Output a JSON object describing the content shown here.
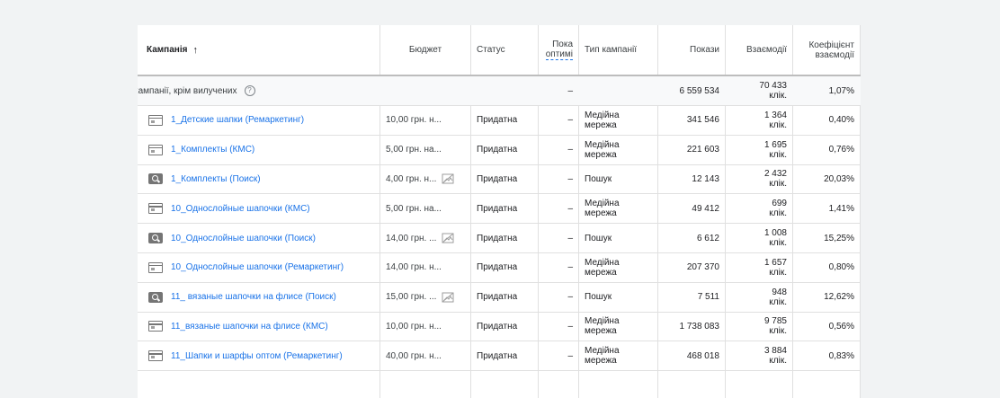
{
  "header": {
    "campaign": "Кампанія",
    "sort_arrow": "↑",
    "budget": "Бюджет",
    "status": "Статус",
    "opt_line1": "Пока",
    "opt_line2": "оптимі",
    "type": "Тип кампанії",
    "impr": "Покази",
    "interactions": "Взаємодії",
    "rate_line1": "Коефіцієнт",
    "rate_line2": "взаємодії"
  },
  "summary": {
    "label": "кампанії, крім вилучених",
    "help": "?",
    "opt": "–",
    "impr": "6 559 534",
    "inter1": "70 433",
    "inter2": "клік.",
    "rate": "1,07%"
  },
  "rows": [
    {
      "icon": "display",
      "name": "1_Детские шапки (Ремаркетинг)",
      "budget": "10,00 грн. н...",
      "noimg": false,
      "status": "Придатна",
      "opt": "–",
      "type1": "Медійна",
      "type2": "мережа",
      "impr": "341 546",
      "inter1": "1 364",
      "inter2": "клік.",
      "rate": "0,40%"
    },
    {
      "icon": "display",
      "name": "1_Комплекты (КМС)",
      "budget": "5,00 грн. на...",
      "noimg": false,
      "status": "Придатна",
      "opt": "–",
      "type1": "Медійна",
      "type2": "мережа",
      "impr": "221 603",
      "inter1": "1 695",
      "inter2": "клік.",
      "rate": "0,76%"
    },
    {
      "icon": "search",
      "name": "1_Комплекты (Поиск)",
      "budget": "4,00 грн. н...",
      "noimg": true,
      "status": "Придатна",
      "opt": "–",
      "type1": "Пошук",
      "type2": "",
      "impr": "12 143",
      "inter1": "2 432",
      "inter2": "клік.",
      "rate": "20,03%"
    },
    {
      "icon": "display",
      "name": "10_Однослойные шапочки (КМС)",
      "budget": "5,00 грн. на...",
      "noimg": false,
      "status": "Придатна",
      "opt": "–",
      "type1": "Медійна",
      "type2": "мережа",
      "impr": "49 412",
      "inter1": "699",
      "inter2": "клік.",
      "rate": "1,41%"
    },
    {
      "icon": "search",
      "name": "10_Однослойные шапочки (Поиск)",
      "budget": "14,00 грн. ...",
      "noimg": true,
      "status": "Придатна",
      "opt": "–",
      "type1": "Пошук",
      "type2": "",
      "impr": "6 612",
      "inter1": "1 008",
      "inter2": "клік.",
      "rate": "15,25%"
    },
    {
      "icon": "display",
      "name": "10_Однослойные шапочки (Ремаркетинг)",
      "budget": "14,00 грн. н...",
      "noimg": false,
      "status": "Придатна",
      "opt": "–",
      "type1": "Медійна",
      "type2": "мережа",
      "impr": "207 370",
      "inter1": "1 657",
      "inter2": "клік.",
      "rate": "0,80%"
    },
    {
      "icon": "search",
      "name": "11_ вязаные шапочки на флисе (Поиск)",
      "budget": "15,00 грн. ...",
      "noimg": true,
      "status": "Придатна",
      "opt": "–",
      "type1": "Пошук",
      "type2": "",
      "impr": "7 511",
      "inter1": "948",
      "inter2": "клік.",
      "rate": "12,62%"
    },
    {
      "icon": "display",
      "name": "11_вязаные шапочки на флисе (КМС)",
      "budget": "10,00 грн. н...",
      "noimg": false,
      "status": "Придатна",
      "opt": "–",
      "type1": "Медійна",
      "type2": "мережа",
      "impr": "1 738 083",
      "inter1": "9 785",
      "inter2": "клік.",
      "rate": "0,56%"
    },
    {
      "icon": "display",
      "name": "11_Шапки и шарфы оптом (Ремаркетинг)",
      "budget": "40,00 грн. н...",
      "noimg": false,
      "status": "Придатна",
      "opt": "–",
      "type1": "Медійна",
      "type2": "мережа",
      "impr": "468 018",
      "inter1": "3 884",
      "inter2": "клік.",
      "rate": "0,83%"
    }
  ]
}
